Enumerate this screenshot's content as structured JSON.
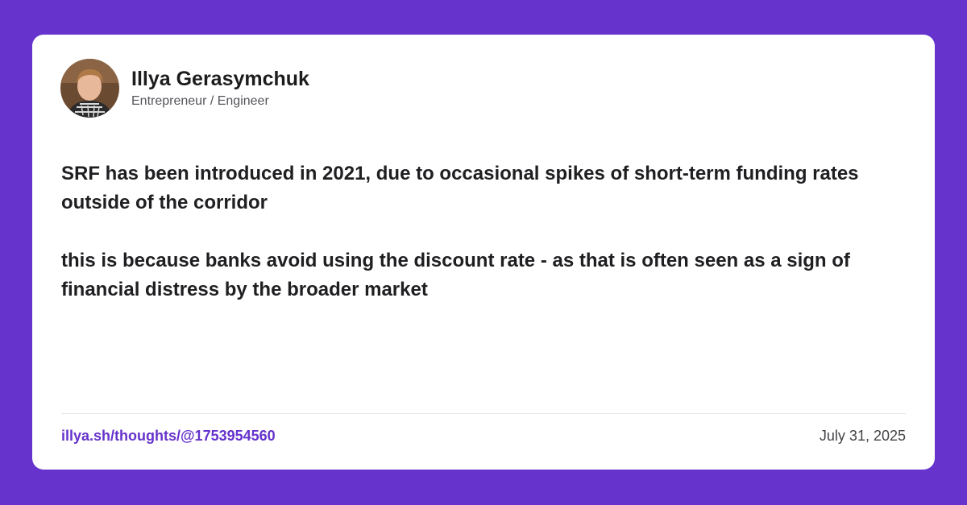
{
  "colors": {
    "background": "#6633cc",
    "card": "#ffffff",
    "link": "#6633cc"
  },
  "author": {
    "name": "Illya Gerasymchuk",
    "role": "Entrepreneur / Engineer",
    "avatar_icon": "avatar-photo"
  },
  "post": {
    "paragraphs": [
      "SRF has been introduced in 2021, due to occasional spikes of short-term funding rates outside of the corridor",
      "this is because banks avoid using the discount rate - as that is often seen as a sign of financial distress by the broader market"
    ]
  },
  "footer": {
    "link": "illya.sh/thoughts/@1753954560",
    "date": "July 31, 2025"
  }
}
